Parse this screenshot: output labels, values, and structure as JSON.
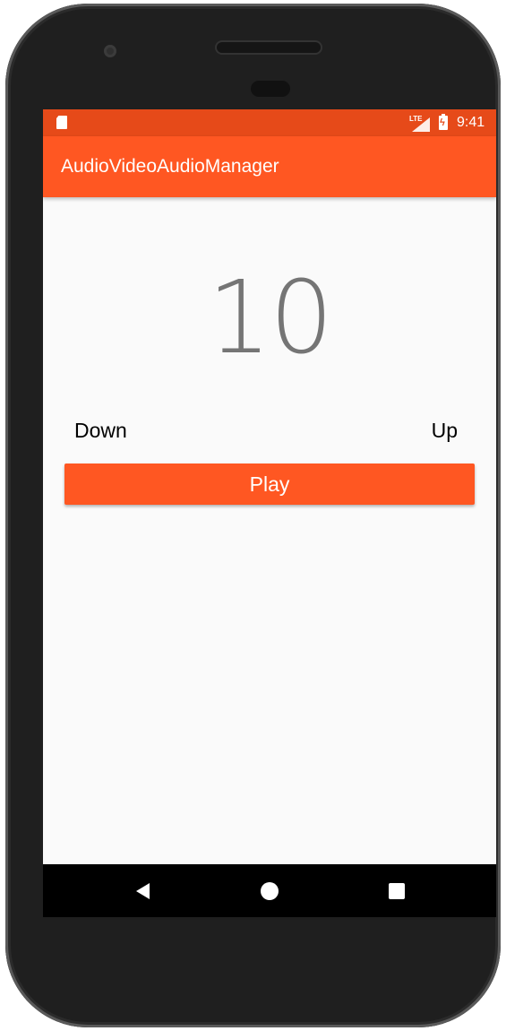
{
  "status_bar": {
    "network": "LTE",
    "time": "9:41"
  },
  "app_bar": {
    "title": "AudioVideoAudioManager"
  },
  "main": {
    "volume_value": "10",
    "down_label": "Down",
    "up_label": "Up",
    "play_label": "Play"
  },
  "colors": {
    "status_bar": "#e64a19",
    "primary": "#ff5722",
    "background": "#fafafa",
    "volume_text": "#757575"
  },
  "icons": {
    "storage": "sd-card-icon",
    "signal": "signal-icon",
    "battery": "battery-charging-icon",
    "back": "back-icon",
    "home": "home-icon",
    "recents": "recents-icon"
  }
}
